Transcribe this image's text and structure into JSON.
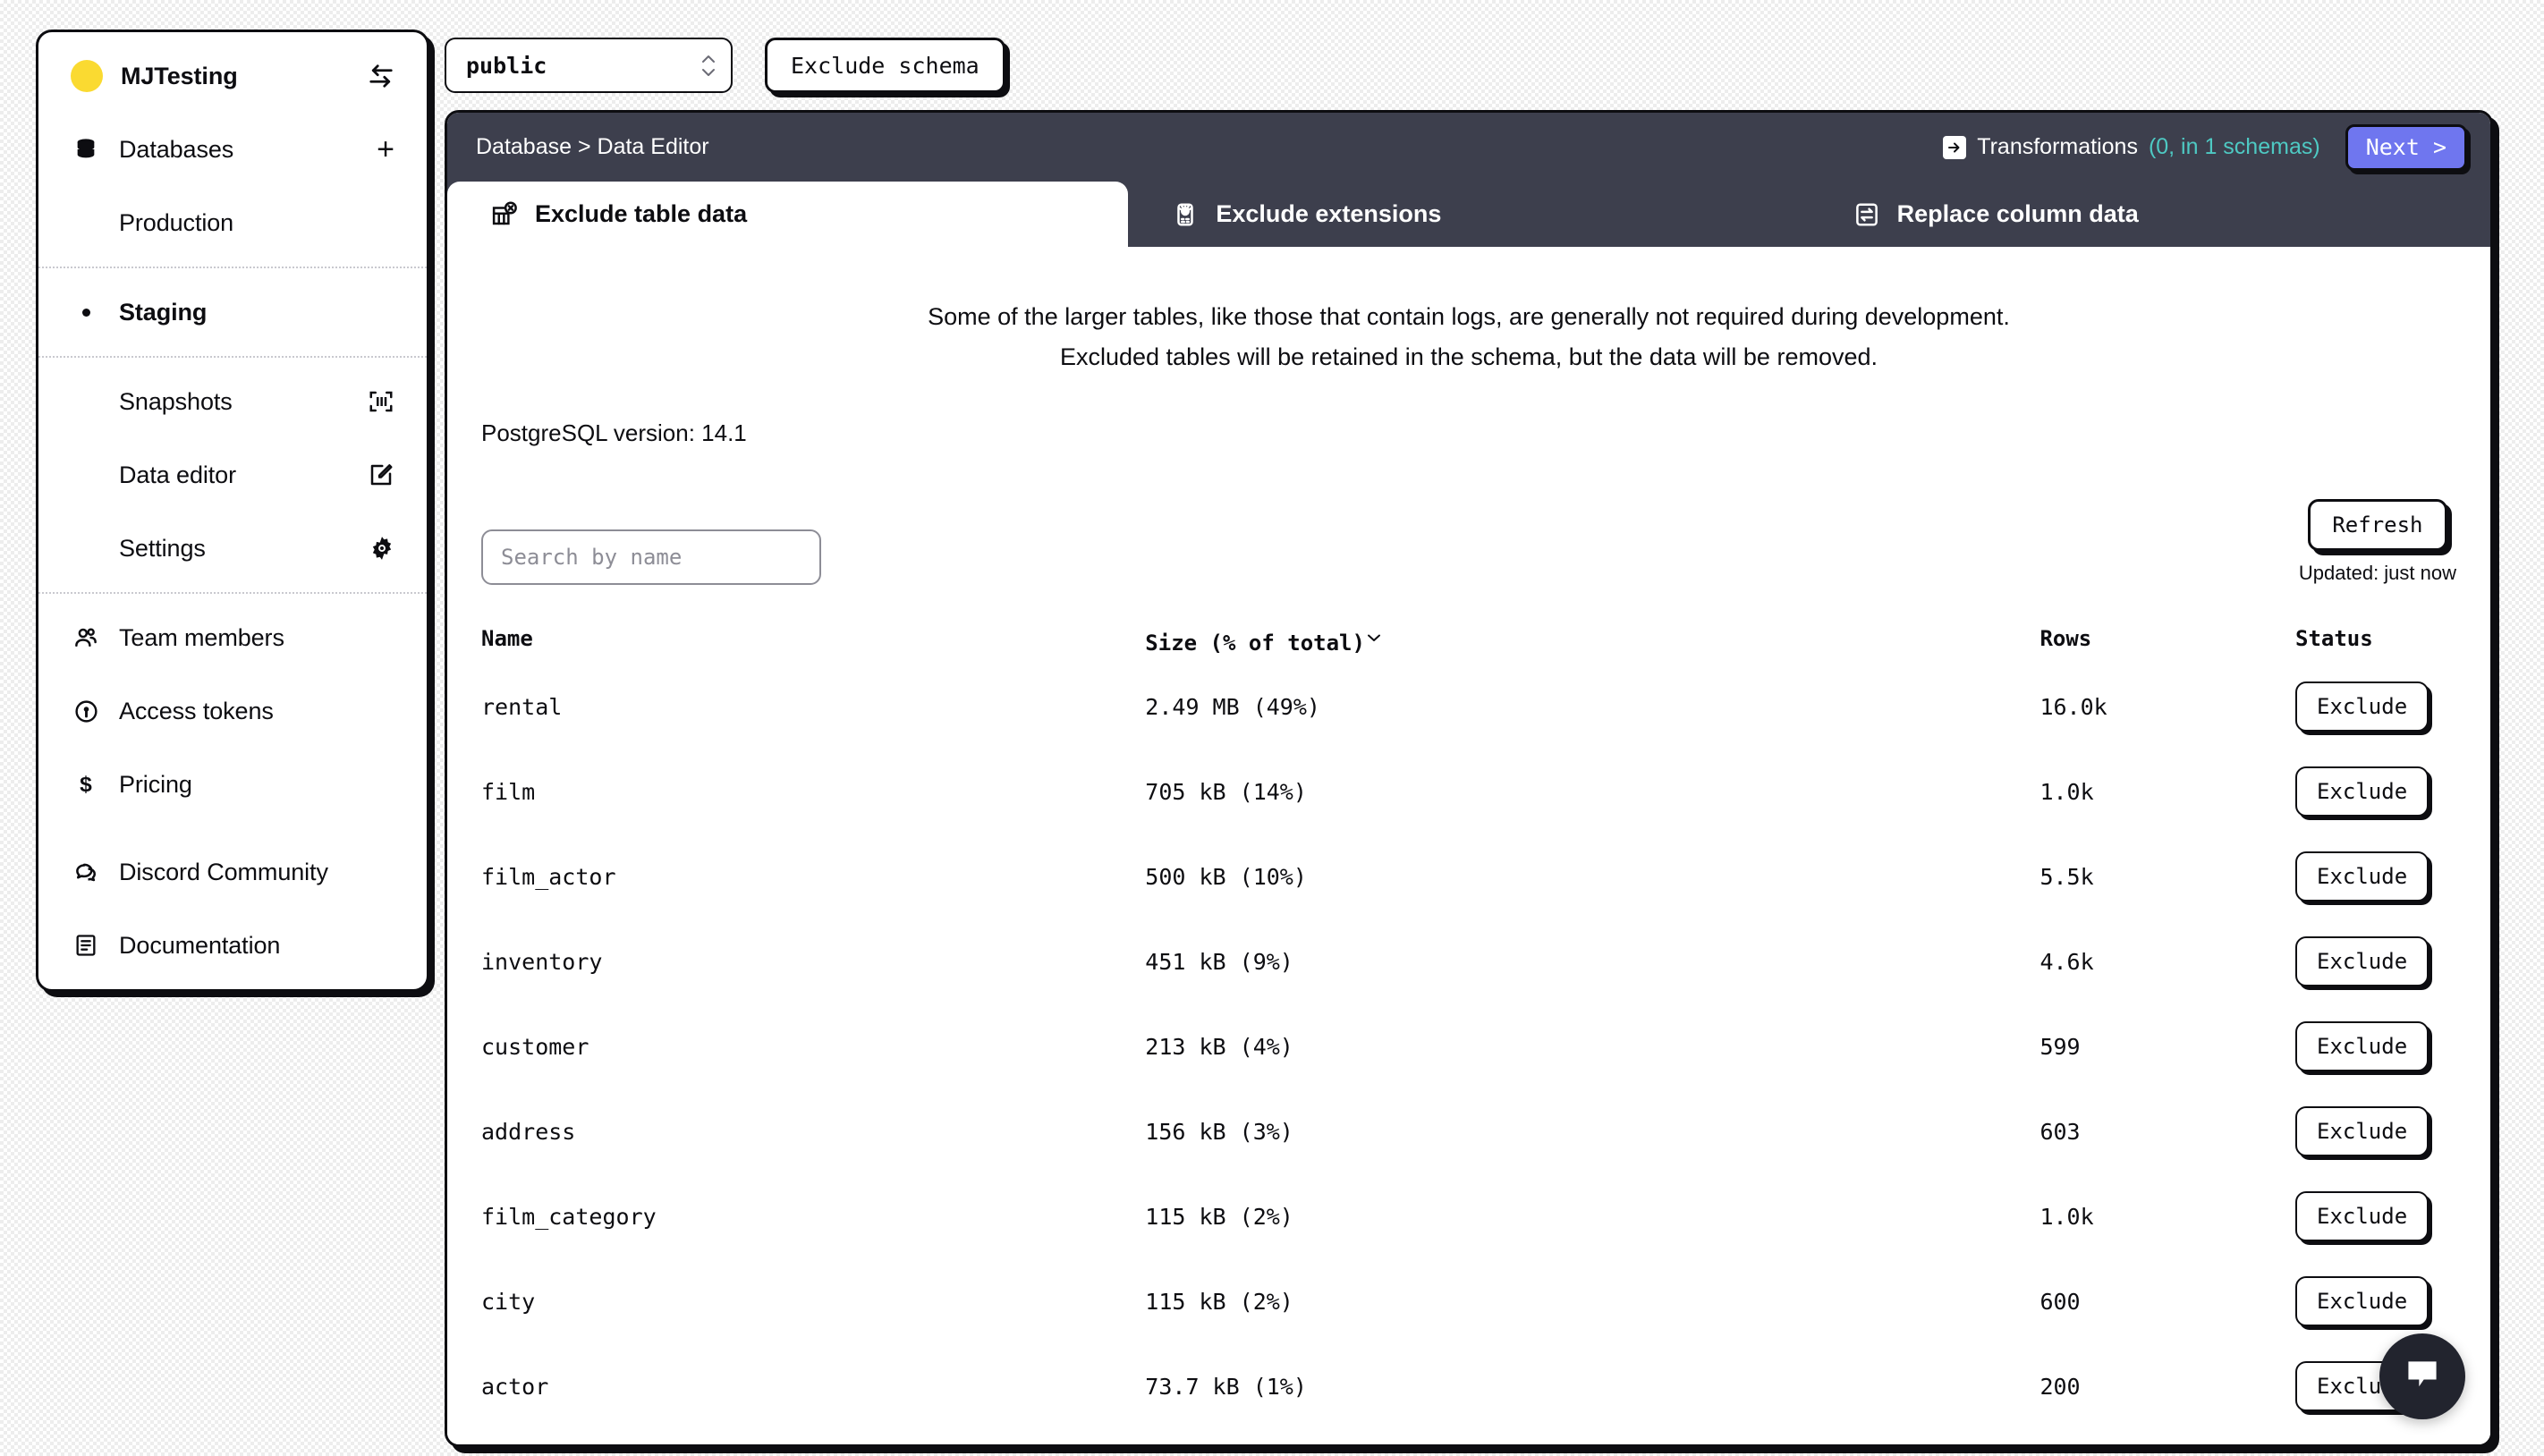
{
  "sidebar": {
    "org": {
      "name": "MJTesting",
      "switch_icon": "switch-arrows-icon",
      "avatar_color": "#fada31"
    },
    "databases": {
      "label": "Databases",
      "icon": "database-icon",
      "add_label": "+"
    },
    "databases_items": [
      {
        "label": "Production",
        "active": false
      },
      {
        "label": "Staging",
        "active": true
      }
    ],
    "staging_children": [
      {
        "label": "Snapshots",
        "icon": "snapshot-icon"
      },
      {
        "label": "Data editor",
        "icon": "edit-square-icon"
      },
      {
        "label": "Settings",
        "icon": "gear-icon"
      }
    ],
    "account_items": [
      {
        "label": "Team members",
        "icon": "users-icon"
      },
      {
        "label": "Access tokens",
        "icon": "key-circle-icon"
      },
      {
        "label": "Pricing",
        "icon": "dollar-icon"
      }
    ],
    "footer_items": [
      {
        "label": "Discord Community",
        "icon": "chat-bubbles-icon"
      },
      {
        "label": "Documentation",
        "icon": "document-icon"
      }
    ]
  },
  "toolbar": {
    "schema_value": "public",
    "exclude_schema_label": "Exclude schema"
  },
  "header": {
    "breadcrumb": "Database > Data Editor",
    "transformations_label": "Transformations",
    "transformations_count": "(0, in 1 schemas)",
    "next_label": "Next >"
  },
  "tabs": [
    {
      "label": "Exclude table data",
      "icon": "table-exclude-icon",
      "active": true
    },
    {
      "label": "Exclude extensions",
      "icon": "extension-icon",
      "active": false
    },
    {
      "label": "Replace column data",
      "icon": "swap-icon",
      "active": false
    }
  ],
  "main": {
    "intro_line1": "Some of the larger tables, like those that contain logs, are generally not required during development.",
    "intro_line2": "Excluded tables will be retained in the schema, but the data will be removed.",
    "pg_version": "PostgreSQL version: 14.1",
    "refresh_label": "Refresh",
    "updated_text": "Updated: just now",
    "search_placeholder": "Search by name",
    "columns": {
      "name": "Name",
      "size": "Size (% of total)",
      "rows": "Rows",
      "status": "Status"
    },
    "sort_indicator": "chevron-down-icon",
    "rows": [
      {
        "name": "rental",
        "size": "2.49 MB (49%)",
        "rows": "16.0k",
        "action": "Exclude"
      },
      {
        "name": "film",
        "size": "705 kB (14%)",
        "rows": "1.0k",
        "action": "Exclude"
      },
      {
        "name": "film_actor",
        "size": "500 kB (10%)",
        "rows": "5.5k",
        "action": "Exclude"
      },
      {
        "name": "inventory",
        "size": "451 kB (9%)",
        "rows": "4.6k",
        "action": "Exclude"
      },
      {
        "name": "customer",
        "size": "213 kB (4%)",
        "rows": "599",
        "action": "Exclude"
      },
      {
        "name": "address",
        "size": "156 kB (3%)",
        "rows": "603",
        "action": "Exclude"
      },
      {
        "name": "film_category",
        "size": "115 kB (2%)",
        "rows": "1.0k",
        "action": "Exclude"
      },
      {
        "name": "city",
        "size": "115 kB (2%)",
        "rows": "600",
        "action": "Exclude"
      },
      {
        "name": "actor",
        "size": "73.7 kB (1%)",
        "rows": "200",
        "action": "Exclude"
      }
    ]
  },
  "chat": {
    "icon": "chat-bubble-icon"
  },
  "colors": {
    "accent_yellow": "#fada31",
    "header_dark": "#3d3f4d",
    "next_button": "#6f76ef",
    "teal_count": "#4ec9c3",
    "ink": "#0d0d11"
  }
}
